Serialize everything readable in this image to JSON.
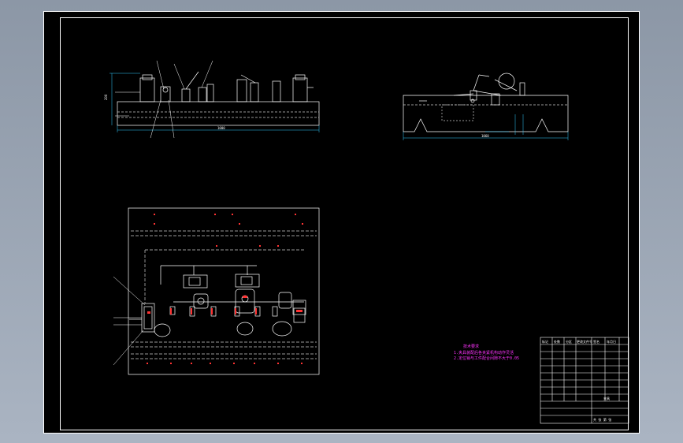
{
  "drawing": {
    "colors": {
      "background": "#000000",
      "frame": "#ffffff",
      "geometry": "#ffffff",
      "dimension": "#33ccff",
      "centerline": "#ff3333",
      "red_marks": "#ff3333",
      "note_text": "#ff33ff",
      "window_bg": "#98a4b4"
    },
    "note": {
      "line1": "技术要求",
      "line2": "1.夹具装配后各夹紧机构动作灵活",
      "line3": "2.定位销与工件配合间隙不大于0.05"
    },
    "front_view": {
      "dim_width": "1000",
      "dim_height": "200"
    },
    "side_view": {
      "dim_width": "1060"
    },
    "title_block": {
      "title_cell": "夹具",
      "rows": [
        "标记",
        "处数",
        "分区",
        "更改文件号",
        "签名",
        "年月日"
      ],
      "sheet": "共 张 第 张"
    }
  }
}
